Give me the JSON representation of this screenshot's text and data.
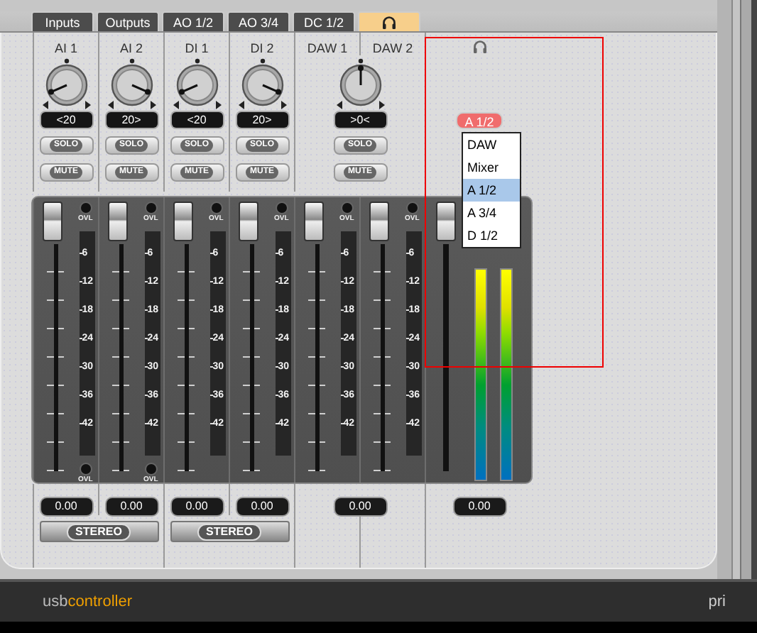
{
  "tabs": [
    {
      "kind": "text",
      "label": "Inputs",
      "selected": false
    },
    {
      "kind": "text",
      "label": "Outputs",
      "selected": false
    },
    {
      "kind": "text",
      "label": "AO 1/2",
      "selected": false
    },
    {
      "kind": "text",
      "label": "AO 3/4",
      "selected": false
    },
    {
      "kind": "text",
      "label": "DC 1/2",
      "selected": false
    },
    {
      "kind": "headphones",
      "selected": true
    }
  ],
  "channels": [
    {
      "name": "AI 1",
      "kind": "mono",
      "pan": {
        "level": 0.08,
        "reading": "<20"
      },
      "solo": {
        "label": "SOLO",
        "on": false
      },
      "mute": {
        "label": "MUTE",
        "on": false
      },
      "fader": {
        "level": 1
      },
      "lamp_label": "OVL",
      "scale": [
        "6",
        "12",
        "18",
        "24",
        "30",
        "36",
        "42"
      ],
      "lower_lamp_label": "OVL",
      "value": "0.00"
    },
    {
      "name": "AI 2",
      "kind": "mono",
      "pan": {
        "level": 0.92,
        "reading": "20>"
      },
      "solo": {
        "label": "SOLO",
        "on": false
      },
      "mute": {
        "label": "MUTE",
        "on": false
      },
      "fader": {
        "level": 1
      },
      "lamp_label": "OVL",
      "scale": [
        "6",
        "12",
        "18",
        "24",
        "30",
        "36",
        "42"
      ],
      "lower_lamp_label": "OVL",
      "value": "0.00"
    },
    {
      "name": "DI 1",
      "kind": "mono",
      "pan": {
        "level": 0.08,
        "reading": "<20"
      },
      "solo": {
        "label": "SOLO",
        "on": false
      },
      "mute": {
        "label": "MUTE",
        "on": false
      },
      "fader": {
        "level": 1
      },
      "lamp_label": "OVL",
      "scale": [
        "6",
        "12",
        "18",
        "24",
        "30",
        "36",
        "42"
      ],
      "value": "0.00"
    },
    {
      "name": "DI 2",
      "kind": "mono",
      "pan": {
        "level": 0.92,
        "reading": "20>"
      },
      "solo": {
        "label": "SOLO",
        "on": false
      },
      "mute": {
        "label": "MUTE",
        "on": false
      },
      "fader": {
        "level": 1
      },
      "lamp_label": "OVL",
      "scale": [
        "6",
        "12",
        "18",
        "24",
        "30",
        "36",
        "42"
      ],
      "value": "0.00"
    },
    {
      "name": "DAW 1",
      "kind": "pair",
      "pan": {
        "level": 0.5,
        "reading": ">0<"
      },
      "solo": {
        "label": "SOLO",
        "on": false
      },
      "mute": {
        "label": "MUTE",
        "on": false
      },
      "fader": {
        "level": 1
      },
      "lamp_label": "OVL",
      "scale": [
        "6",
        "12",
        "18",
        "24",
        "30",
        "36",
        "42"
      ],
      "value": "0.00"
    },
    {
      "name": "DAW 2",
      "kind": "linked",
      "fader": {
        "level": 1
      },
      "lamp_label": "OVL",
      "scale": [
        "6",
        "12",
        "18",
        "24",
        "30",
        "36",
        "42"
      ]
    }
  ],
  "stereo_links": [
    "STEREO",
    "STEREO"
  ],
  "headphones": {
    "source": "A 1/2",
    "menu": [
      {
        "label": "DAW",
        "selected": false
      },
      {
        "label": "Mixer",
        "selected": false
      },
      {
        "label": "A 1/2",
        "selected": true
      },
      {
        "label": "A 3/4",
        "selected": false
      },
      {
        "label": "D 1/2",
        "selected": false
      }
    ],
    "fader": {
      "level": 1
    },
    "meters": [
      {
        "level": 1
      },
      {
        "level": 1
      }
    ],
    "value": "0.00"
  },
  "footer": {
    "product_prefix": "usb",
    "product_name": "controller",
    "vendor": "pri"
  }
}
